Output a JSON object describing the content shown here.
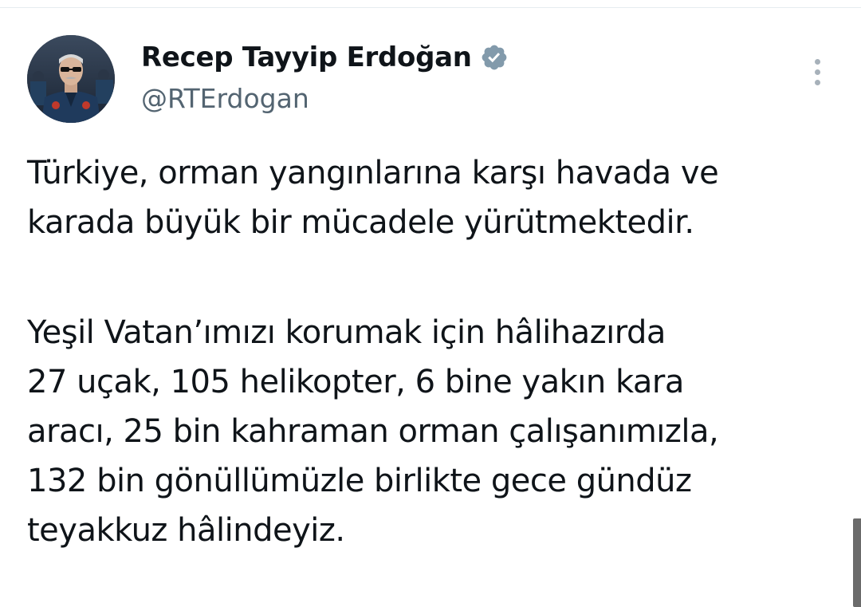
{
  "author": {
    "display_name": "Recep Tayyip Erdoğan",
    "handle": "@RTErdogan",
    "verified_icon": "verified-badge-icon",
    "verified_color": "#829aab"
  },
  "tweet": {
    "paragraph_1": [
      "Türkiye, orman yangınlarına karşı havada ve",
      "karada büyük bir mücadele yürütmektedir."
    ],
    "paragraph_2": [
      "Yeşil Vatan’ımızı korumak için hâlihazırda",
      "27 uçak, 105 helikopter, 6 bine yakın kara",
      "aracı, 25 bin kahraman orman çalışanımızla,",
      "132 bin gönüllümüzle birlikte gece gündüz",
      "teyakkuz hâlindeyiz."
    ]
  },
  "icons": {
    "more": "more-vertical-icon"
  }
}
